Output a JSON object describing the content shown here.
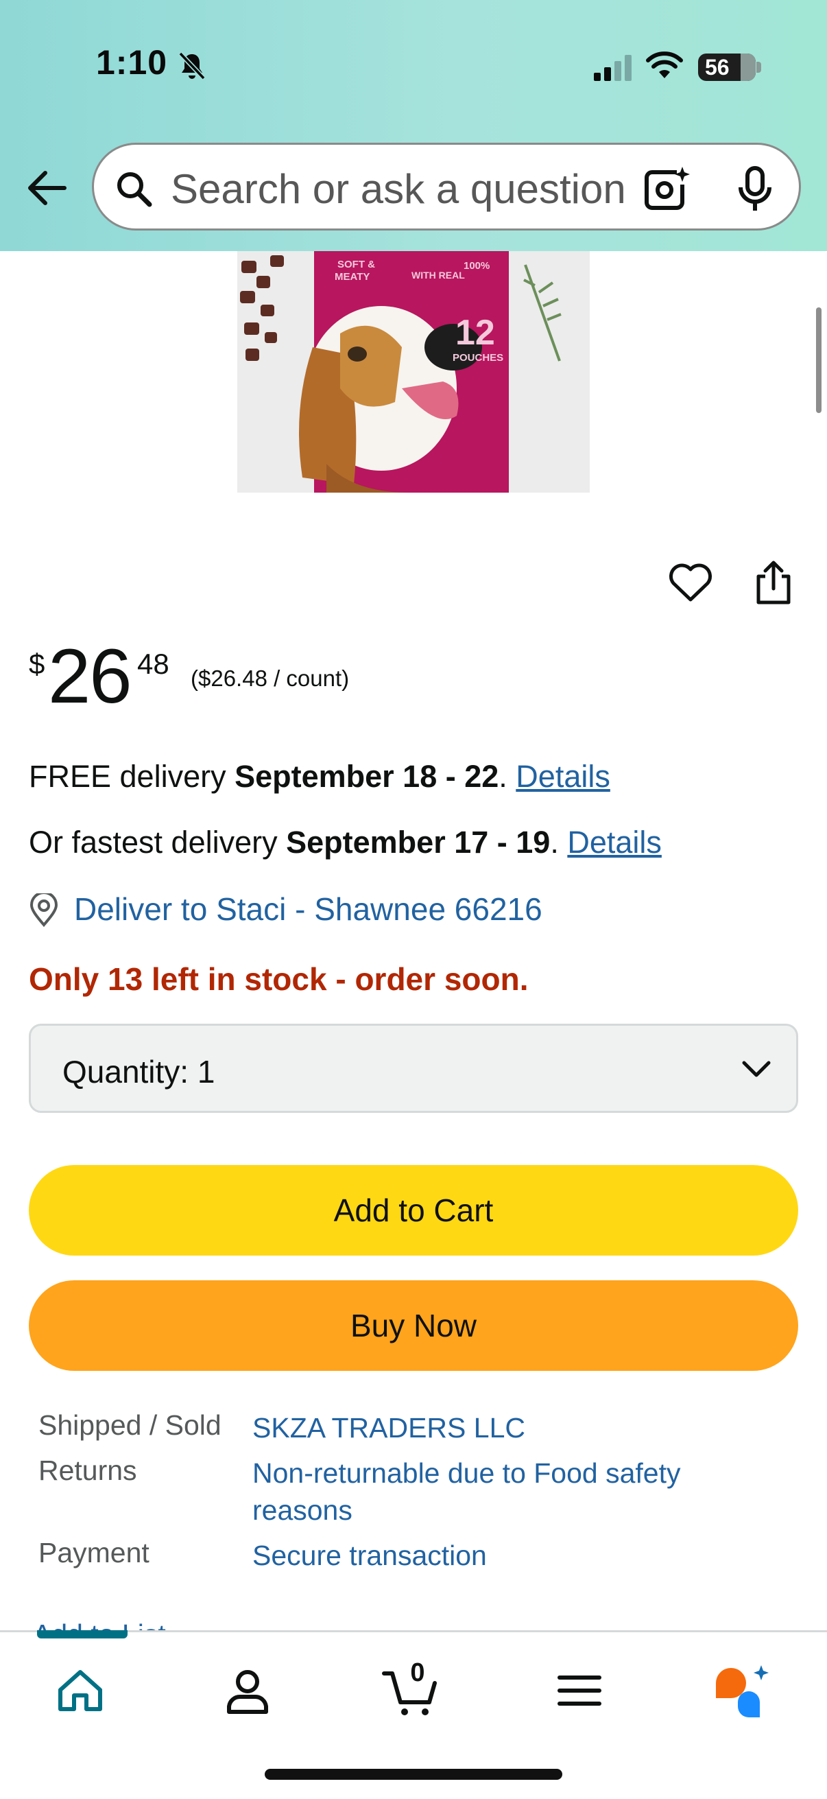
{
  "status_bar": {
    "time": "1:10",
    "battery_level": "56",
    "icons": [
      "bell-slash-icon",
      "cellular-signal-icon",
      "wifi-icon",
      "battery-icon"
    ]
  },
  "header": {
    "search_placeholder": "Search or ask a question",
    "icons": [
      "back-arrow-icon",
      "search-icon",
      "camera-lens-icon",
      "microphone-icon"
    ],
    "gradient_colors": [
      "#8fd8d6",
      "#a2e6d6"
    ]
  },
  "product_image": {
    "badge_top_left": "SOFT & MEATY TEXTURE",
    "badge_top_middle": "WITH REAL BEEF",
    "badge_top_right": "100%",
    "count": "12",
    "count_unit": "POUCHES"
  },
  "actions": {
    "icons": [
      "heart-icon",
      "share-icon"
    ]
  },
  "price": {
    "currency": "$",
    "whole": "26",
    "fraction": "48",
    "unit_price": "($26.48 / count)"
  },
  "delivery": {
    "free_prefix": "FREE delivery ",
    "free_dates": "September 18 - 22",
    "free_sep": ". ",
    "free_link": "Details",
    "fast_prefix": "Or fastest delivery ",
    "fast_dates": "September 17 - 19",
    "fast_sep": ". ",
    "fast_link": "Details",
    "deliver_to": "Deliver to Staci - Shawnee 66216"
  },
  "stock": {
    "message": "Only 13 left in stock - order soon.",
    "color": "#b12704"
  },
  "quantity": {
    "label": "Quantity:",
    "value": "1"
  },
  "buttons": {
    "add_to_cart": "Add to Cart",
    "buy_now": "Buy Now",
    "add_to_cart_color": "#ffd814",
    "buy_now_color": "#ffa41c"
  },
  "details": {
    "shipped_label": "Shipped / Sold",
    "shipped_value": "SKZA TRADERS LLC",
    "returns_label": "Returns",
    "returns_value": "Non-returnable due to Food safety reasons",
    "payment_label": "Payment",
    "payment_value": "Secure transaction",
    "partial_link": "Add to List"
  },
  "bottom_nav": {
    "items": [
      "home-icon",
      "account-icon",
      "cart-icon",
      "menu-icon",
      "rufus-icon"
    ],
    "cart_count": "0",
    "active_color": "#007185"
  }
}
